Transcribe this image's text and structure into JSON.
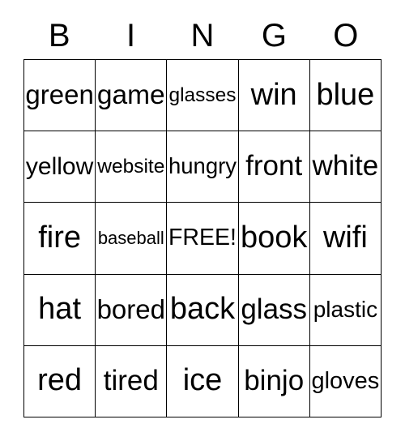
{
  "card": {
    "header_letters": [
      "B",
      "I",
      "N",
      "G",
      "O"
    ],
    "rows": [
      [
        "green",
        "game",
        "glasses",
        "win",
        "blue"
      ],
      [
        "yellow",
        "website",
        "hungry",
        "front",
        "white"
      ],
      [
        "fire",
        "baseball",
        "FREE!",
        "book",
        "wifi"
      ],
      [
        "hat",
        "bored",
        "back",
        "glass",
        "plastic"
      ],
      [
        "red",
        "tired",
        "ice",
        "binjo",
        "gloves"
      ]
    ],
    "free_space": "FREE!",
    "colors": {
      "background": "#ffffff",
      "text": "#000000",
      "border": "#000000"
    }
  }
}
